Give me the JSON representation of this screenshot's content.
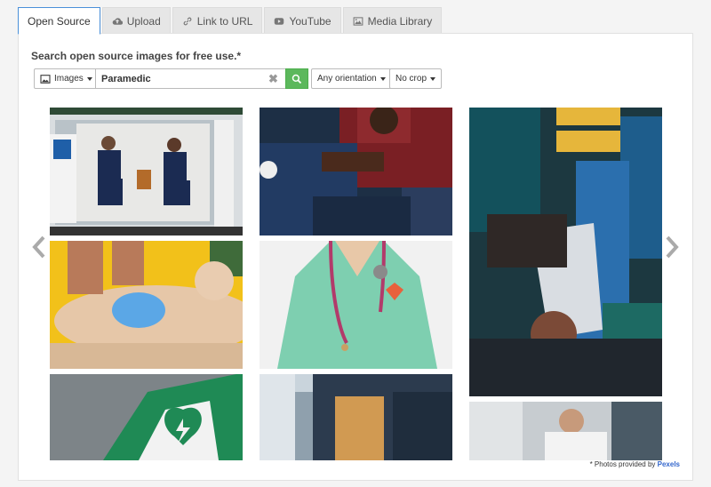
{
  "tabs": [
    {
      "label": "Open Source",
      "icon": "none",
      "active": true
    },
    {
      "label": "Upload",
      "icon": "cloud-upload-icon"
    },
    {
      "label": "Link to URL",
      "icon": "link-icon"
    },
    {
      "label": "YouTube",
      "icon": "youtube-icon"
    },
    {
      "label": "Media Library",
      "icon": "image-icon"
    }
  ],
  "search": {
    "heading": "Search open source images for free use.*",
    "type_label": "Images",
    "query": "Paramedic",
    "orientation_label": "Any orientation",
    "crop_label": "No crop"
  },
  "photos": [
    {
      "name": "photo-paramedics-in-ambulance"
    },
    {
      "name": "photo-patient-chest-pain"
    },
    {
      "name": "photo-bandaging-hand"
    },
    {
      "name": "photo-cpr-mannequin"
    },
    {
      "name": "photo-nurse-stethoscope"
    },
    {
      "name": "photo-aed-sign"
    },
    {
      "name": "photo-ambulance-stretcher"
    },
    {
      "name": "photo-doctor-patient"
    }
  ],
  "footer": {
    "credit_prefix": "* Photos provided by",
    "credit_link": "Pexels"
  },
  "colors": {
    "active_tab_border": "#4a90d9",
    "search_button": "#5cb85c",
    "credit_link": "#3366cc"
  }
}
